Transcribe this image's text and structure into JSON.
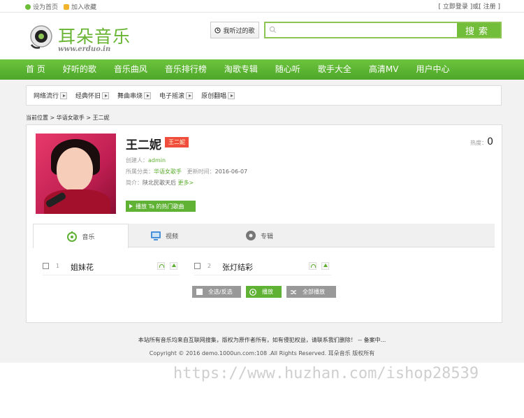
{
  "topbar": {
    "set_home": "设为首页",
    "add_favorite": "加入收藏",
    "login_register": "[ 立即登录 ]或[ 注册 ]"
  },
  "logo": {
    "cn": "耳朵音乐",
    "en": "www.erduo.in"
  },
  "header": {
    "history_label": "我听过的歌",
    "search_placeholder": "",
    "search_button": "搜索"
  },
  "nav": [
    "首 页",
    "好听的歌",
    "音乐曲风",
    "音乐排行榜",
    "淘歌专辑",
    "随心听",
    "歌手大全",
    "高清MV",
    "用户中心"
  ],
  "subnav": [
    "网络流行",
    "经典怀旧",
    "舞曲串烧",
    "电子摇滚",
    "原创翻唱"
  ],
  "breadcrumb": "当前位置 > 华语女歌手 > 王二妮",
  "artist": {
    "name": "王二妮",
    "tag": "王二妮",
    "heat_label": "热度：",
    "heat_value": "0",
    "creator_label": "创建人：",
    "creator": "admin",
    "category_label": "所属分类：",
    "category": "华语女歌手",
    "updated_label": "更新时间：",
    "updated": "2016-06-07",
    "intro_label": "简介：",
    "intro": "陕北民歌天后",
    "more": "更多>",
    "play_button": "播放 Ta 的热门歌曲"
  },
  "tabs": [
    "音乐",
    "视频",
    "专辑"
  ],
  "songs": [
    {
      "num": "1",
      "title": "姐妹花"
    },
    {
      "num": "2",
      "title": "张灯结彩"
    }
  ],
  "controls": {
    "select_all": "全选/反选",
    "play": "播放",
    "play_all": "全部播放"
  },
  "footer": {
    "line1": "本站所有音乐均来自互联网搜集，版权为原作者所有，如有侵犯权益，请联系我们删除！ -- 备案中...",
    "line2": "Copyright © 2016 demo.1000un.com:108 .All Rights Reserved. 耳朵音乐 版权所有"
  },
  "watermark": "https://www.huzhan.com/ishop28539",
  "colors": {
    "accent": "#5fb234",
    "nav": "#5cb334",
    "tag": "#f04d3c"
  }
}
